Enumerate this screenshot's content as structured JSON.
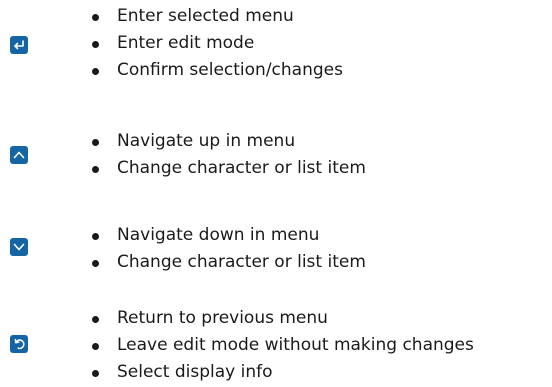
{
  "keys": [
    {
      "icon": "enter-key-icon",
      "items": [
        "Enter selected menu",
        "Enter edit mode",
        "Confirm selection/changes"
      ]
    },
    {
      "icon": "arrow-up-key-icon",
      "items": [
        "Navigate up in menu",
        "Change character or list item"
      ]
    },
    {
      "icon": "arrow-down-key-icon",
      "items": [
        "Navigate down in menu",
        "Change character or list item"
      ]
    },
    {
      "icon": "back-key-icon",
      "items": [
        "Return to previous menu",
        "Leave edit mode without making changes",
        "Select display info"
      ]
    }
  ],
  "colors": {
    "icon_background": "#1565a6",
    "icon_glyph": "#ffffff",
    "text": "#1a1a1a"
  }
}
